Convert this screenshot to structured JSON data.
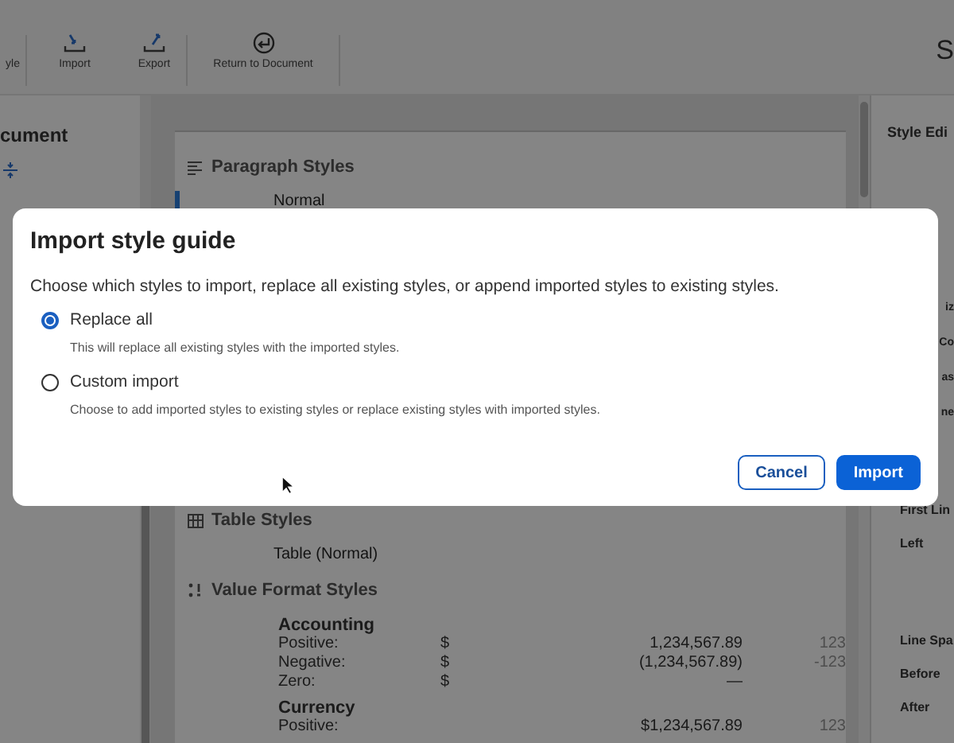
{
  "toolbar": {
    "items": [
      {
        "label": "yle"
      },
      {
        "label": "Import"
      },
      {
        "label": "Export"
      },
      {
        "label": "Return to Document"
      }
    ],
    "title": "S"
  },
  "left_panel": {
    "title": "cument"
  },
  "document": {
    "sections": [
      {
        "title": "Paragraph Styles",
        "items": [
          {
            "text": "Normal",
            "selected": true
          }
        ]
      },
      {
        "title": "Table Styles",
        "items": [
          {
            "text": "Table (Normal)",
            "selected": false
          }
        ]
      },
      {
        "title": "Value Format Styles"
      }
    ],
    "formats": [
      {
        "name": "Accounting",
        "rows": [
          {
            "label": "Positive:",
            "symbol": "$",
            "value": "1,234,567.89",
            "sample": "123"
          },
          {
            "label": "Negative:",
            "symbol": "$",
            "value": "(1,234,567.89)",
            "sample": "-123"
          },
          {
            "label": "Zero:",
            "symbol": "$",
            "value": "—"
          }
        ]
      },
      {
        "name": "Currency",
        "rows": [
          {
            "label": "Positive:",
            "value": "$1,234,567.89",
            "sample": "123"
          }
        ]
      }
    ]
  },
  "right_panel": {
    "title": "Style Edi",
    "labels": [
      {
        "text": "iz",
        "kind": "partial"
      },
      {
        "text": "Co",
        "kind": "partial"
      },
      {
        "text": "as",
        "kind": "partial"
      },
      {
        "text": "ne",
        "kind": "partial"
      },
      {
        "text": "First Lin",
        "kind": "full"
      },
      {
        "text": "Left",
        "kind": "full"
      },
      {
        "text": "Line Spa",
        "kind": "full"
      },
      {
        "text": "Before",
        "kind": "full"
      },
      {
        "text": "After",
        "kind": "full"
      }
    ]
  },
  "dialog": {
    "title": "Import style guide",
    "description": "Choose which styles to import, replace all existing styles, or append imported styles to existing styles.",
    "options": [
      {
        "label": "Replace all",
        "hint": "This will replace all existing styles with the imported styles.",
        "selected": true
      },
      {
        "label": "Custom import",
        "hint": "Choose to add imported styles to existing styles or replace existing styles with imported styles.",
        "selected": false
      }
    ],
    "buttons": [
      {
        "label": "Cancel",
        "kind": "secondary"
      },
      {
        "label": "Import",
        "kind": "primary"
      }
    ]
  }
}
